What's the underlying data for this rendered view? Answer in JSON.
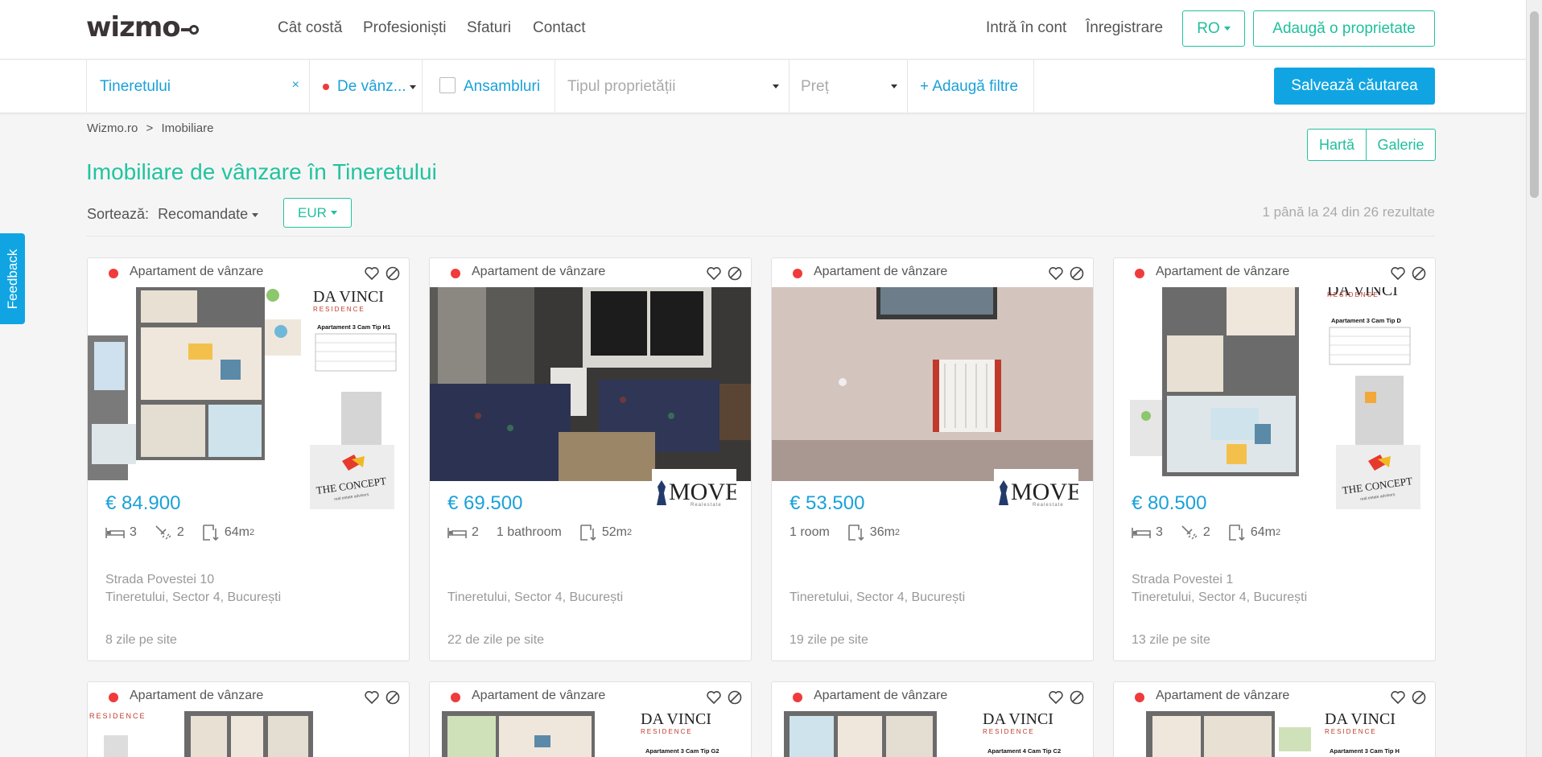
{
  "header": {
    "logo": "wizmo",
    "nav": [
      "Cât costă",
      "Profesioniști",
      "Sfaturi",
      "Contact"
    ],
    "login": "Intră în cont",
    "register": "Înregistrare",
    "language": "RO",
    "add_property": "Adaugă o proprietate"
  },
  "filters": {
    "location": "Tineretului",
    "transaction": "De vânz...",
    "ensembles": "Ansambluri",
    "property_type_placeholder": "Tipul proprietății",
    "price_placeholder": "Preț",
    "add_filters": "+ Adaugă filtre",
    "save_search": "Salvează căutarea"
  },
  "breadcrumb": {
    "home": "Wizmo.ro",
    "separator": ">",
    "current": "Imobiliare"
  },
  "view_toggle": {
    "map": "Hartă",
    "gallery": "Galerie"
  },
  "page_title": "Imobiliare de vânzare în Tineretului",
  "sort": {
    "label": "Sortează:",
    "value": "Recomandate",
    "currency": "EUR"
  },
  "results_summary": "1 până la 24 din 26 rezultate",
  "feedback": "Feedback",
  "colors": {
    "accent_green": "#22c3a0",
    "accent_blue": "#1aa1d9",
    "button_blue": "#10a5e2",
    "status_red": "#ef3b3b"
  },
  "listings": [
    {
      "type": "Apartament de vânzare",
      "price": "€ 84.900",
      "rooms": "3",
      "bathrooms": "2",
      "area": "64m",
      "area_sup": "2",
      "street": "Strada Povestei 10",
      "area_name": "Tineretului, Sector 4, București",
      "days": "8 zile pe site",
      "agency": "THE CONCEPT",
      "agency_sub": "real estate advisors",
      "photo_kind": "floorplan",
      "brand": "DA VINCI",
      "brand_sub": "RESIDENCE",
      "plan_title": "Apartament 3 Cam Tip H1"
    },
    {
      "type": "Apartament de vânzare",
      "price": "€ 69.500",
      "rooms": "2",
      "bathrooms_text": "1 bathroom",
      "area": "52m",
      "area_sup": "2",
      "area_name": "Tineretului, Sector 4, București",
      "days": "22 de zile pe site",
      "agency": "MOVE",
      "agency_sub": "Realestate",
      "photo_kind": "livingroom"
    },
    {
      "type": "Apartament de vânzare",
      "price": "€ 53.500",
      "rooms_text": "1 room",
      "area": "36m",
      "area_sup": "2",
      "area_name": "Tineretului, Sector 4, București",
      "days": "19 zile pe site",
      "agency": "MOVE",
      "agency_sub": "Realestate",
      "photo_kind": "emptyroom"
    },
    {
      "type": "Apartament de vânzare",
      "price": "€ 80.500",
      "rooms": "3",
      "bathrooms": "2",
      "area": "64m",
      "area_sup": "2",
      "street": "Strada Povestei 1",
      "area_name": "Tineretului, Sector 4, București",
      "days": "13 zile pe site",
      "agency": "THE CONCEPT",
      "agency_sub": "real estate advisors",
      "photo_kind": "floorplan",
      "brand": "DA VINCI",
      "brand_sub": "RESIDENCE",
      "plan_title": "Apartament 3 Cam Tip D"
    }
  ],
  "listings_row2": [
    {
      "type": "Apartament de vânzare",
      "brand_sub": "RESIDENCE"
    },
    {
      "type": "Apartament de vânzare",
      "brand": "DA VINCI",
      "brand_sub": "RESIDENCE",
      "plan_title": "Apartament 3 Cam Tip G2"
    },
    {
      "type": "Apartament de vânzare",
      "brand": "DA VINCI",
      "brand_sub": "RESIDENCE",
      "plan_title": "Apartament 4 Cam Tip C2"
    },
    {
      "type": "Apartament de vânzare",
      "brand": "DA VINCI",
      "brand_sub": "RESIDENCE",
      "plan_title": "Apartament 3 Cam Tip H"
    }
  ]
}
